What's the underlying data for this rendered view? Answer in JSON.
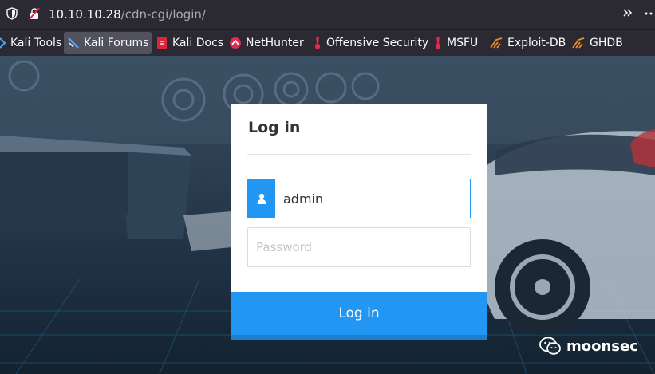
{
  "browser": {
    "url_host": "10.10.10.28",
    "url_path": "/cdn-cgi/login/",
    "bookmarks": [
      {
        "label": "Kali Tools",
        "icon": "kali-dragon-icon"
      },
      {
        "label": "Kali Forums",
        "icon": "kali-forums-icon",
        "active": true
      },
      {
        "label": "Kali Docs",
        "icon": "kali-docs-icon"
      },
      {
        "label": "NetHunter",
        "icon": "nethunter-icon"
      },
      {
        "label": "Offensive Security",
        "icon": "offsec-icon"
      },
      {
        "label": "MSFU",
        "icon": "msfu-icon"
      },
      {
        "label": "Exploit-DB",
        "icon": "exploit-db-icon"
      },
      {
        "label": "GHDB",
        "icon": "ghdb-icon"
      }
    ]
  },
  "login": {
    "title": "Log in",
    "username_value": "admin",
    "password_placeholder": "Password",
    "submit_label": "Log in"
  },
  "watermark": {
    "text": "moonsec"
  },
  "colors": {
    "accent": "#2196f3",
    "browser_bar": "#2b2a33",
    "card": "#ffffff"
  }
}
